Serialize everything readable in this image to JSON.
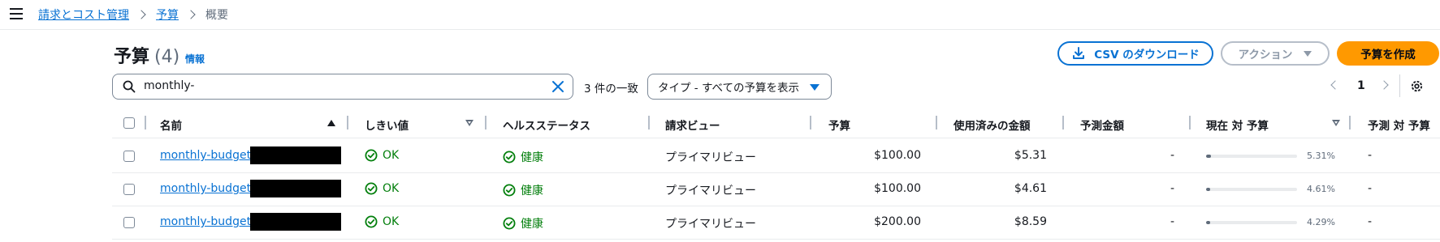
{
  "breadcrumb": {
    "items": [
      "請求とコスト管理",
      "予算"
    ],
    "current": "概要"
  },
  "header": {
    "title": "予算",
    "count": "(4)",
    "info": "情報",
    "csv_button": "CSV のダウンロード",
    "action_button": "アクション",
    "create_button": "予算を作成"
  },
  "filter": {
    "search_value": "monthly-",
    "match_count": "3 件の一致",
    "type_select": "タイプ - すべての予算を表示"
  },
  "pagination": {
    "page": "1"
  },
  "table": {
    "columns": [
      "名前",
      "しきい値",
      "ヘルスステータス",
      "請求ビュー",
      "予算",
      "使用済みの金額",
      "予測金額",
      "現在 対 予算",
      "予測 対 予算"
    ],
    "rows": [
      {
        "name": "monthly-budget-",
        "threshold": "OK",
        "health": "健康",
        "billing_view": "プライマリビュー",
        "budget": "$100.00",
        "used": "$5.31",
        "forecast": "-",
        "current_vs_budget": "5.31%",
        "current_fraction": 0.0531,
        "forecast_vs_budget": "-"
      },
      {
        "name": "monthly-budget-",
        "threshold": "OK",
        "health": "健康",
        "billing_view": "プライマリビュー",
        "budget": "$100.00",
        "used": "$4.61",
        "forecast": "-",
        "current_vs_budget": "4.61%",
        "current_fraction": 0.0461,
        "forecast_vs_budget": "-"
      },
      {
        "name": "monthly-budget-",
        "threshold": "OK",
        "health": "健康",
        "billing_view": "プライマリビュー",
        "budget": "$200.00",
        "used": "$8.59",
        "forecast": "-",
        "current_vs_budget": "4.29%",
        "current_fraction": 0.0429,
        "forecast_vs_budget": "-"
      }
    ]
  },
  "icons": {
    "menu": "menu-icon",
    "breadcrumb_separator": "chevron-right-icon",
    "download": "download-icon",
    "search": "search-icon",
    "clear": "close-icon",
    "settings": "gear-icon",
    "status_ok": "check-circle-icon"
  },
  "colors": {
    "link": "#0972d3",
    "primary_button": "#ff9900",
    "success": "#037f0c",
    "text": "#16191f",
    "muted": "#5f6b7a"
  }
}
